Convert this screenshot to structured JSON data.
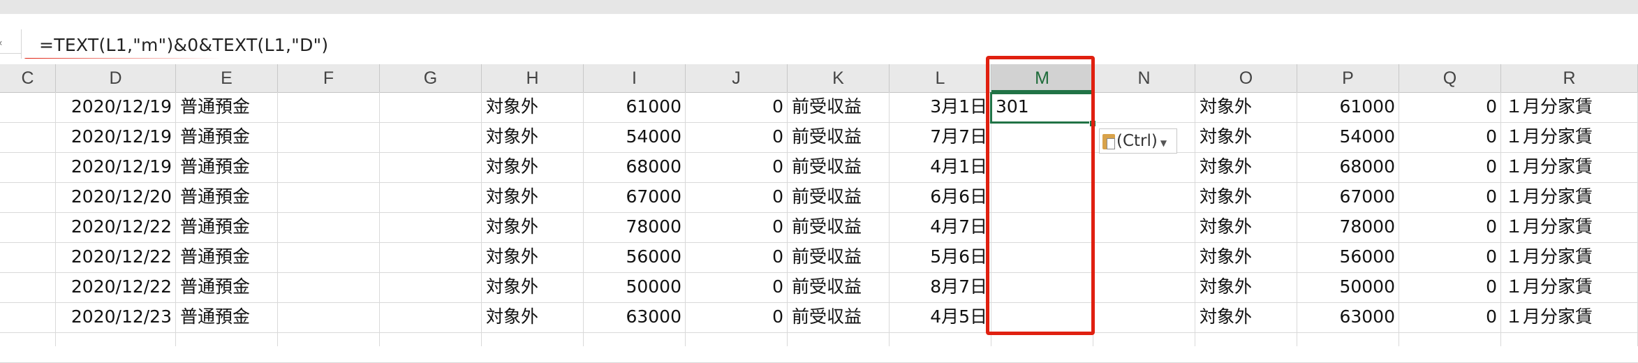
{
  "formula_bar": {
    "formula": "=TEXT(L1,\"m\")&0&TEXT(L1,\"D\")"
  },
  "columns": [
    "C",
    "D",
    "E",
    "F",
    "G",
    "H",
    "I",
    "J",
    "K",
    "L",
    "M",
    "N",
    "O",
    "P",
    "Q",
    "R"
  ],
  "selected_column": "M",
  "rows": [
    {
      "D": "2020/12/19",
      "E": "普通預金",
      "H": "対象外",
      "I": "61000",
      "J": "0",
      "K": "前受収益",
      "L": "3月1日",
      "M": "301",
      "O": "対象外",
      "P": "61000",
      "Q": "0",
      "R": "１月分家賃"
    },
    {
      "D": "2020/12/19",
      "E": "普通預金",
      "H": "対象外",
      "I": "54000",
      "J": "0",
      "K": "前受収益",
      "L": "7月7日",
      "M": "",
      "O": "対象外",
      "P": "54000",
      "Q": "0",
      "R": "１月分家賃"
    },
    {
      "D": "2020/12/19",
      "E": "普通預金",
      "H": "対象外",
      "I": "68000",
      "J": "0",
      "K": "前受収益",
      "L": "4月1日",
      "M": "",
      "O": "対象外",
      "P": "68000",
      "Q": "0",
      "R": "１月分家賃"
    },
    {
      "D": "2020/12/20",
      "E": "普通預金",
      "H": "対象外",
      "I": "67000",
      "J": "0",
      "K": "前受収益",
      "L": "6月6日",
      "M": "",
      "O": "対象外",
      "P": "67000",
      "Q": "0",
      "R": "１月分家賃"
    },
    {
      "D": "2020/12/22",
      "E": "普通預金",
      "H": "対象外",
      "I": "78000",
      "J": "0",
      "K": "前受収益",
      "L": "4月7日",
      "M": "",
      "O": "対象外",
      "P": "78000",
      "Q": "0",
      "R": "１月分家賃"
    },
    {
      "D": "2020/12/22",
      "E": "普通預金",
      "H": "対象外",
      "I": "56000",
      "J": "0",
      "K": "前受収益",
      "L": "5月6日",
      "M": "",
      "O": "対象外",
      "P": "56000",
      "Q": "0",
      "R": "１月分家賃"
    },
    {
      "D": "2020/12/22",
      "E": "普通預金",
      "H": "対象外",
      "I": "50000",
      "J": "0",
      "K": "前受収益",
      "L": "8月7日",
      "M": "",
      "O": "対象外",
      "P": "50000",
      "Q": "0",
      "R": "１月分家賃"
    },
    {
      "D": "2020/12/23",
      "E": "普通預金",
      "H": "対象外",
      "I": "63000",
      "J": "0",
      "K": "前受収益",
      "L": "4月5日",
      "M": "",
      "O": "対象外",
      "P": "63000",
      "Q": "0",
      "R": "１月分家賃"
    }
  ],
  "paste_options": {
    "label": "(Ctrl)",
    "icon": "clipboard-icon"
  },
  "colors": {
    "annotation_red": "#e02010",
    "selection_green": "#217346"
  }
}
